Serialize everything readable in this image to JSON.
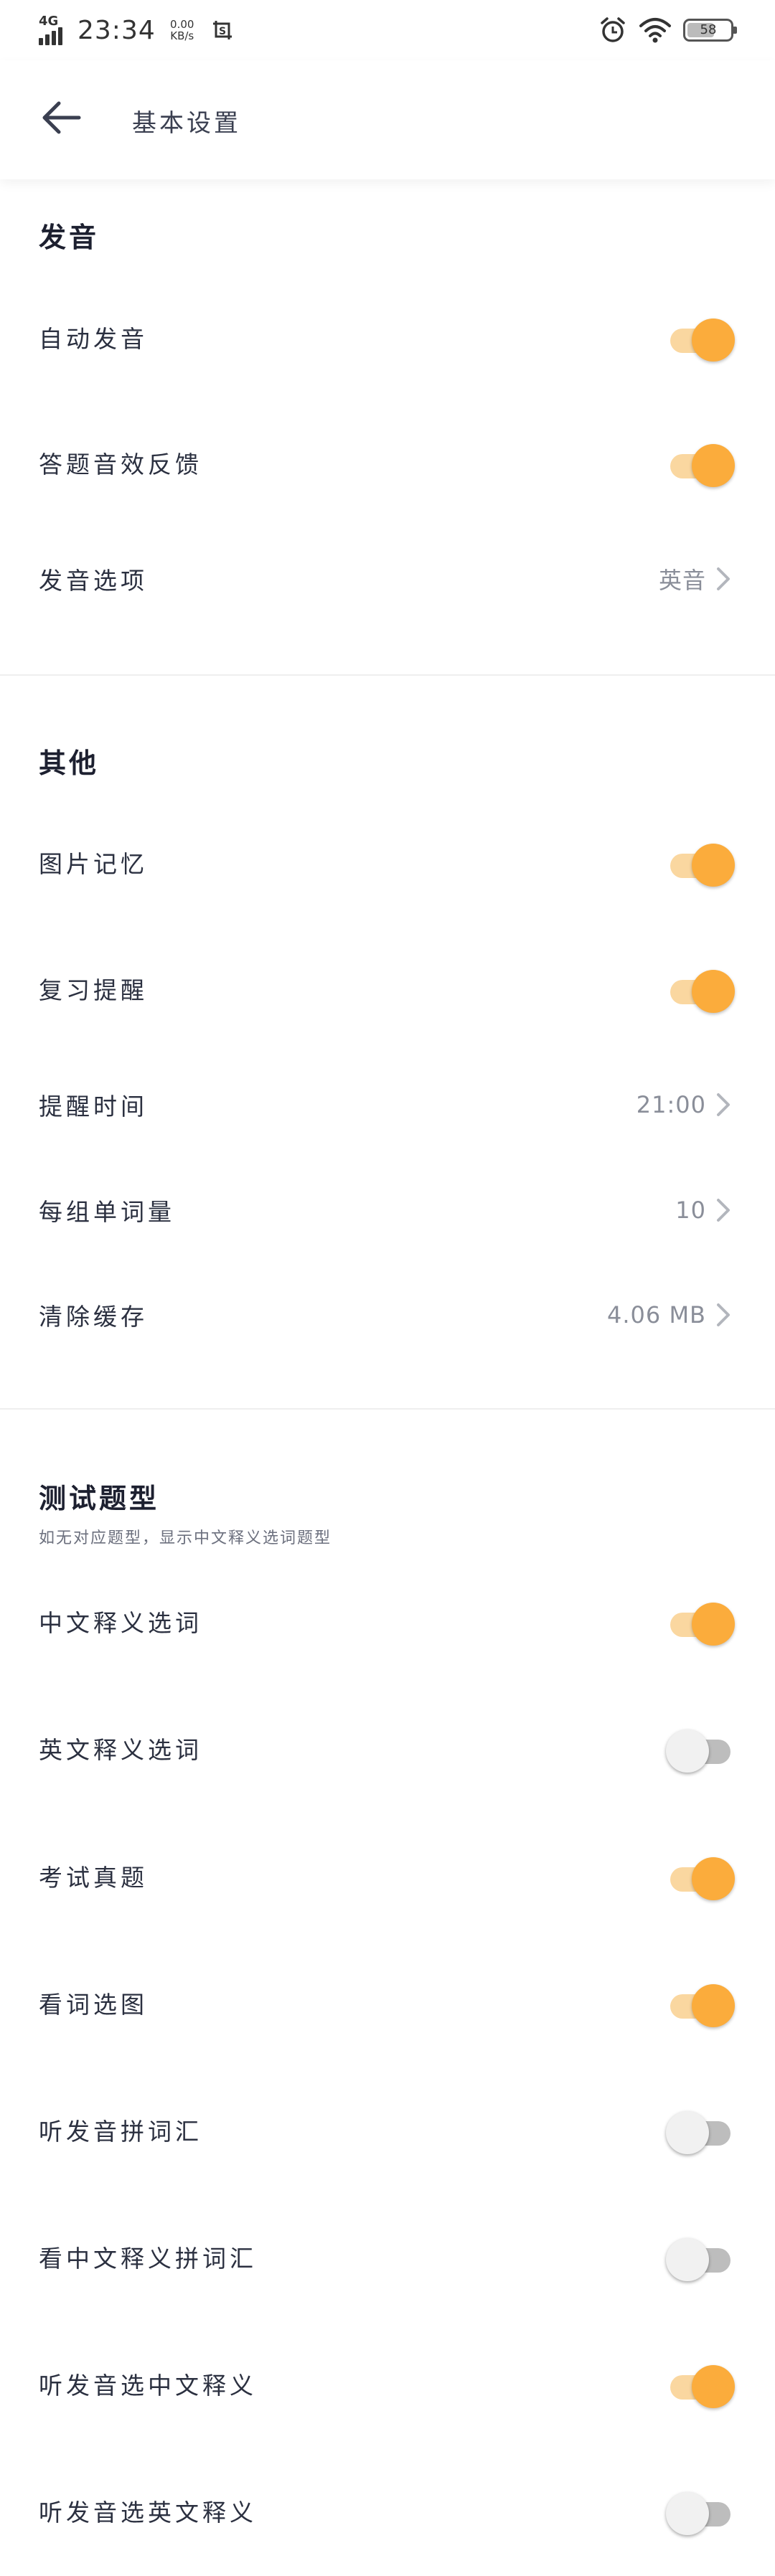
{
  "status_bar": {
    "network": "4G",
    "time": "23:34",
    "speed_value": "0.00",
    "speed_unit": "KB/s",
    "battery": "58"
  },
  "header": {
    "title": "基本设置"
  },
  "sections": {
    "pronunciation": {
      "title": "发音",
      "auto_play": {
        "label": "自动发音",
        "on": true
      },
      "answer_feedback": {
        "label": "答题音效反馈",
        "on": true
      },
      "accent": {
        "label": "发音选项",
        "value": "英音"
      }
    },
    "other": {
      "title": "其他",
      "image_memory": {
        "label": "图片记忆",
        "on": true
      },
      "review_reminder": {
        "label": "复习提醒",
        "on": true
      },
      "reminder_time": {
        "label": "提醒时间",
        "value": "21:00"
      },
      "words_per_group": {
        "label": "每组单词量",
        "value": "10"
      },
      "clear_cache": {
        "label": "清除缓存",
        "value": "4.06 MB"
      }
    },
    "test_types": {
      "title": "测试题型",
      "subtitle": "如无对应题型，显示中文释义选词题型",
      "items": [
        {
          "label": "中文释义选词",
          "on": true
        },
        {
          "label": "英文释义选词",
          "on": false
        },
        {
          "label": "考试真题",
          "on": true
        },
        {
          "label": "看词选图",
          "on": true
        },
        {
          "label": "听发音拼词汇",
          "on": false
        },
        {
          "label": "看中文释义拼词汇",
          "on": false
        },
        {
          "label": "听发音选中文释义",
          "on": true
        },
        {
          "label": "听发音选英文释义",
          "on": false
        }
      ]
    }
  },
  "colors": {
    "accent": "#fbac3c",
    "accent_track": "#fad7a0",
    "off_track": "#bdbdbd",
    "off_thumb": "#f1f1f1",
    "secondary_text": "#8a8e99"
  }
}
